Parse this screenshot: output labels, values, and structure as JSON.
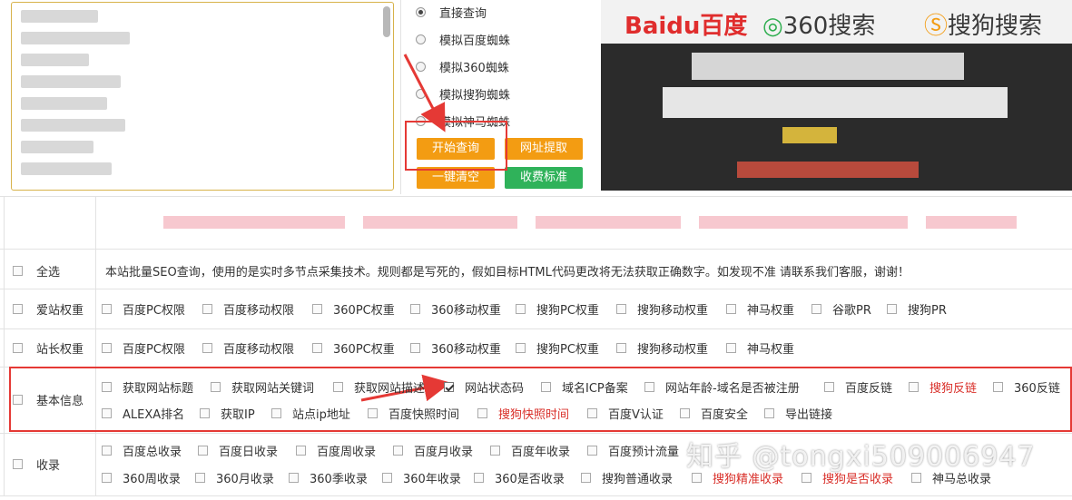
{
  "radio_options": [
    {
      "label": "直接查询",
      "selected": true
    },
    {
      "label": "模拟百度蜘蛛",
      "selected": false
    },
    {
      "label": "模拟360蜘蛛",
      "selected": false
    },
    {
      "label": "模拟搜狗蜘蛛",
      "selected": false
    },
    {
      "label": "模拟神马蜘蛛",
      "selected": false
    }
  ],
  "buttons": {
    "start_query": "开始查询",
    "url_extract": "网址提取",
    "clear_all": "一键清空",
    "pricing": "收费标准"
  },
  "colors": {
    "orange": "#f39c12",
    "green": "#2fb25a",
    "highlight_red": "#e53935",
    "red_text": "#d9302a"
  },
  "preview": {
    "logos": [
      "Baidu百度",
      "360搜索",
      "搜狗搜索"
    ]
  },
  "table": {
    "select_all_label": "全选",
    "notice": "本站批量SEO查询，使用的是实时多节点采集技术。规则都是写死的，假如目标HTML代码更改将无法获取正确数字。如发现不准 请联系我们客服，谢谢！",
    "rows": [
      {
        "label": "爱站权重",
        "options": [
          {
            "text": "百度PC权限",
            "checked": false,
            "red": false
          },
          {
            "text": "百度移动权限",
            "checked": false,
            "red": false
          },
          {
            "text": "360PC权重",
            "checked": false,
            "red": false
          },
          {
            "text": "360移动权重",
            "checked": false,
            "red": false
          },
          {
            "text": "搜狗PC权重",
            "checked": false,
            "red": false
          },
          {
            "text": "搜狗移动权重",
            "checked": false,
            "red": false
          },
          {
            "text": "神马权重",
            "checked": false,
            "red": false
          },
          {
            "text": "谷歌PR",
            "checked": false,
            "red": false
          },
          {
            "text": "搜狗PR",
            "checked": false,
            "red": false
          }
        ]
      },
      {
        "label": "站长权重",
        "options": [
          {
            "text": "百度PC权限",
            "checked": false,
            "red": false
          },
          {
            "text": "百度移动权限",
            "checked": false,
            "red": false
          },
          {
            "text": "360PC权重",
            "checked": false,
            "red": false
          },
          {
            "text": "360移动权重",
            "checked": false,
            "red": false
          },
          {
            "text": "搜狗PC权重",
            "checked": false,
            "red": false
          },
          {
            "text": "搜狗移动权重",
            "checked": false,
            "red": false
          },
          {
            "text": "神马权重",
            "checked": false,
            "red": false
          }
        ]
      },
      {
        "label": "基本信息",
        "options": [
          {
            "text": "获取网站标题",
            "checked": false,
            "red": false
          },
          {
            "text": "获取网站关键词",
            "checked": false,
            "red": false
          },
          {
            "text": "获取网站描述",
            "checked": false,
            "red": false
          },
          {
            "text": "网站状态码",
            "checked": true,
            "red": false
          },
          {
            "text": "域名ICP备案",
            "checked": false,
            "red": false
          },
          {
            "text": "网站年龄-域名是否被注册",
            "checked": false,
            "red": false
          },
          {
            "text": "百度反链",
            "checked": false,
            "red": false
          },
          {
            "text": "搜狗反链",
            "checked": false,
            "red": true
          },
          {
            "text": "360反链",
            "checked": false,
            "red": false
          },
          {
            "text": "ALEXA排名",
            "checked": false,
            "red": false
          },
          {
            "text": "获取IP",
            "checked": false,
            "red": false
          },
          {
            "text": "站点ip地址",
            "checked": false,
            "red": false
          },
          {
            "text": "百度快照时间",
            "checked": false,
            "red": false
          },
          {
            "text": "搜狗快照时间",
            "checked": false,
            "red": true
          },
          {
            "text": "百度V认证",
            "checked": false,
            "red": false
          },
          {
            "text": "百度安全",
            "checked": false,
            "red": false
          },
          {
            "text": "导出链接",
            "checked": false,
            "red": false
          }
        ]
      },
      {
        "label": "收录",
        "options": [
          {
            "text": "百度总收录",
            "checked": false,
            "red": false
          },
          {
            "text": "百度日收录",
            "checked": false,
            "red": false
          },
          {
            "text": "百度周收录",
            "checked": false,
            "red": false
          },
          {
            "text": "百度月收录",
            "checked": false,
            "red": false
          },
          {
            "text": "百度年收录",
            "checked": false,
            "red": false
          },
          {
            "text": "百度预计流量",
            "checked": false,
            "red": false
          },
          {
            "text": "360周收录",
            "checked": false,
            "red": false
          },
          {
            "text": "360月收录",
            "checked": false,
            "red": false
          },
          {
            "text": "360季收录",
            "checked": false,
            "red": false
          },
          {
            "text": "360年收录",
            "checked": false,
            "red": false
          },
          {
            "text": "360是否收录",
            "checked": false,
            "red": false
          },
          {
            "text": "搜狗普通收录",
            "checked": false,
            "red": false
          },
          {
            "text": "搜狗精准收录",
            "checked": false,
            "red": true
          },
          {
            "text": "搜狗是否收录",
            "checked": false,
            "red": true
          },
          {
            "text": "神马总收录",
            "checked": false,
            "red": false
          }
        ]
      }
    ]
  },
  "watermark": "知乎 @tongxi509006947"
}
